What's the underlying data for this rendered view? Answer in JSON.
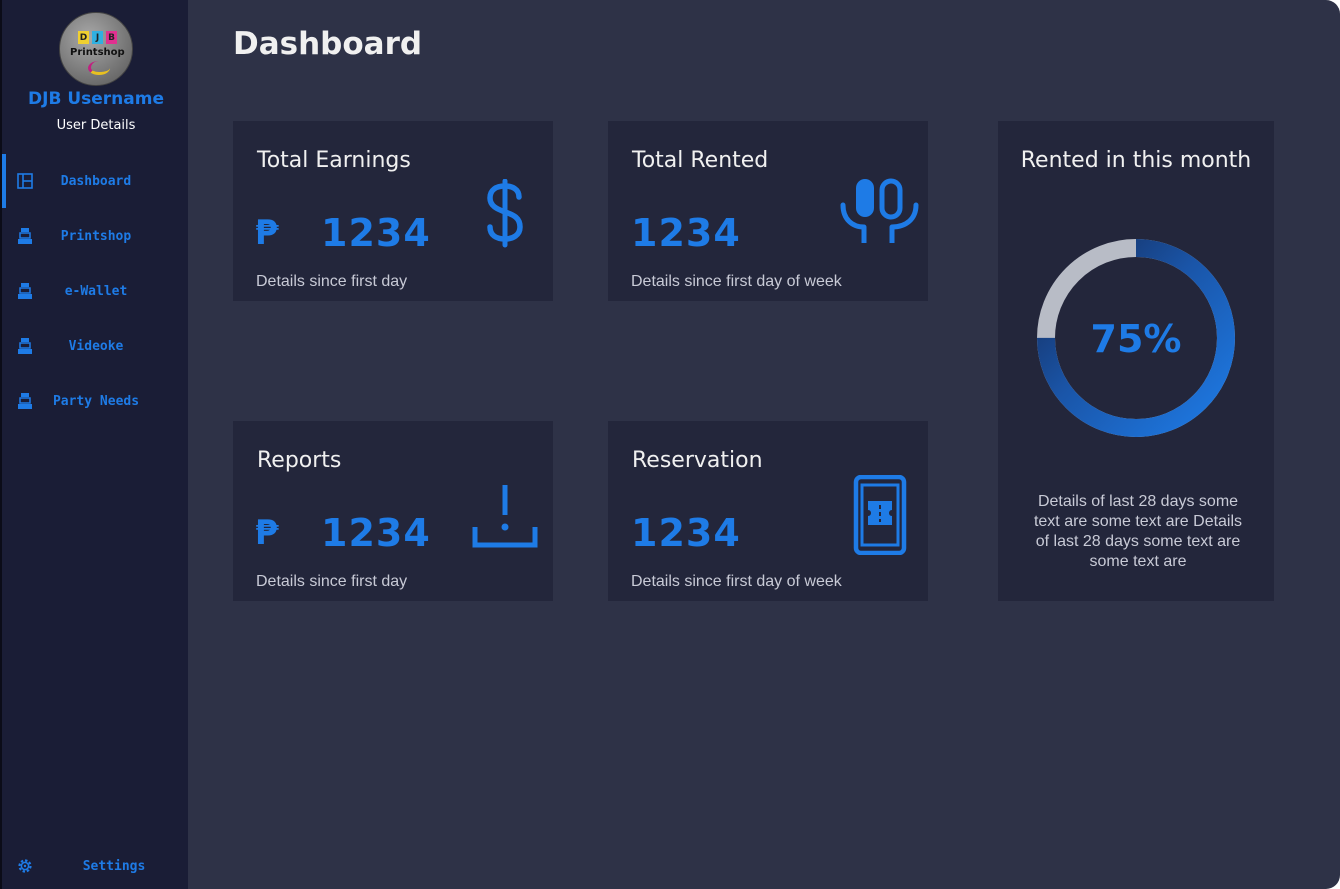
{
  "colors": {
    "accent": "#1e7be6",
    "sidebar_bg": "#1a1d36",
    "main_bg": "#2e3247",
    "card_bg": "#23263b",
    "ring_track": "#b8bcc6"
  },
  "profile": {
    "logo_letters": [
      "D",
      "J",
      "B"
    ],
    "logo_text": "Printshop",
    "username": "DJB Username",
    "details": "User Details"
  },
  "sidebar": {
    "items": [
      {
        "label": "Dashboard",
        "icon": "dashboard-icon",
        "active": true
      },
      {
        "label": "Printshop",
        "icon": "cash-register-icon",
        "active": false
      },
      {
        "label": "e-Wallet",
        "icon": "cash-register-icon",
        "active": false
      },
      {
        "label": "Videoke",
        "icon": "cash-register-icon",
        "active": false
      },
      {
        "label": "Party Needs",
        "icon": "cash-register-icon",
        "active": false
      }
    ],
    "settings": {
      "label": "Settings",
      "icon": "gear-icon"
    }
  },
  "main": {
    "title": "Dashboard",
    "cards": [
      {
        "title": "Total Earnings",
        "currency": "₱",
        "value": "1234",
        "detail": "Details since first day",
        "icon": "dollar-icon"
      },
      {
        "title": "Total Rented",
        "value": "1234",
        "detail": "Details since first day of week",
        "icon": "microphone-icon"
      },
      {
        "title": "Reports",
        "currency": "₱",
        "value": "1234",
        "detail": "Details since first day",
        "icon": "download-tray-icon"
      },
      {
        "title": "Reservation",
        "value": "1234",
        "detail": "Details since first day of week",
        "icon": "phone-ticket-icon"
      }
    ],
    "rented_month": {
      "title": "Rented in this month",
      "percent_label": "75%",
      "percent": 75,
      "detail": "Details of last 28 days some text are some text are Details of last 28 days some text are some text are"
    }
  }
}
